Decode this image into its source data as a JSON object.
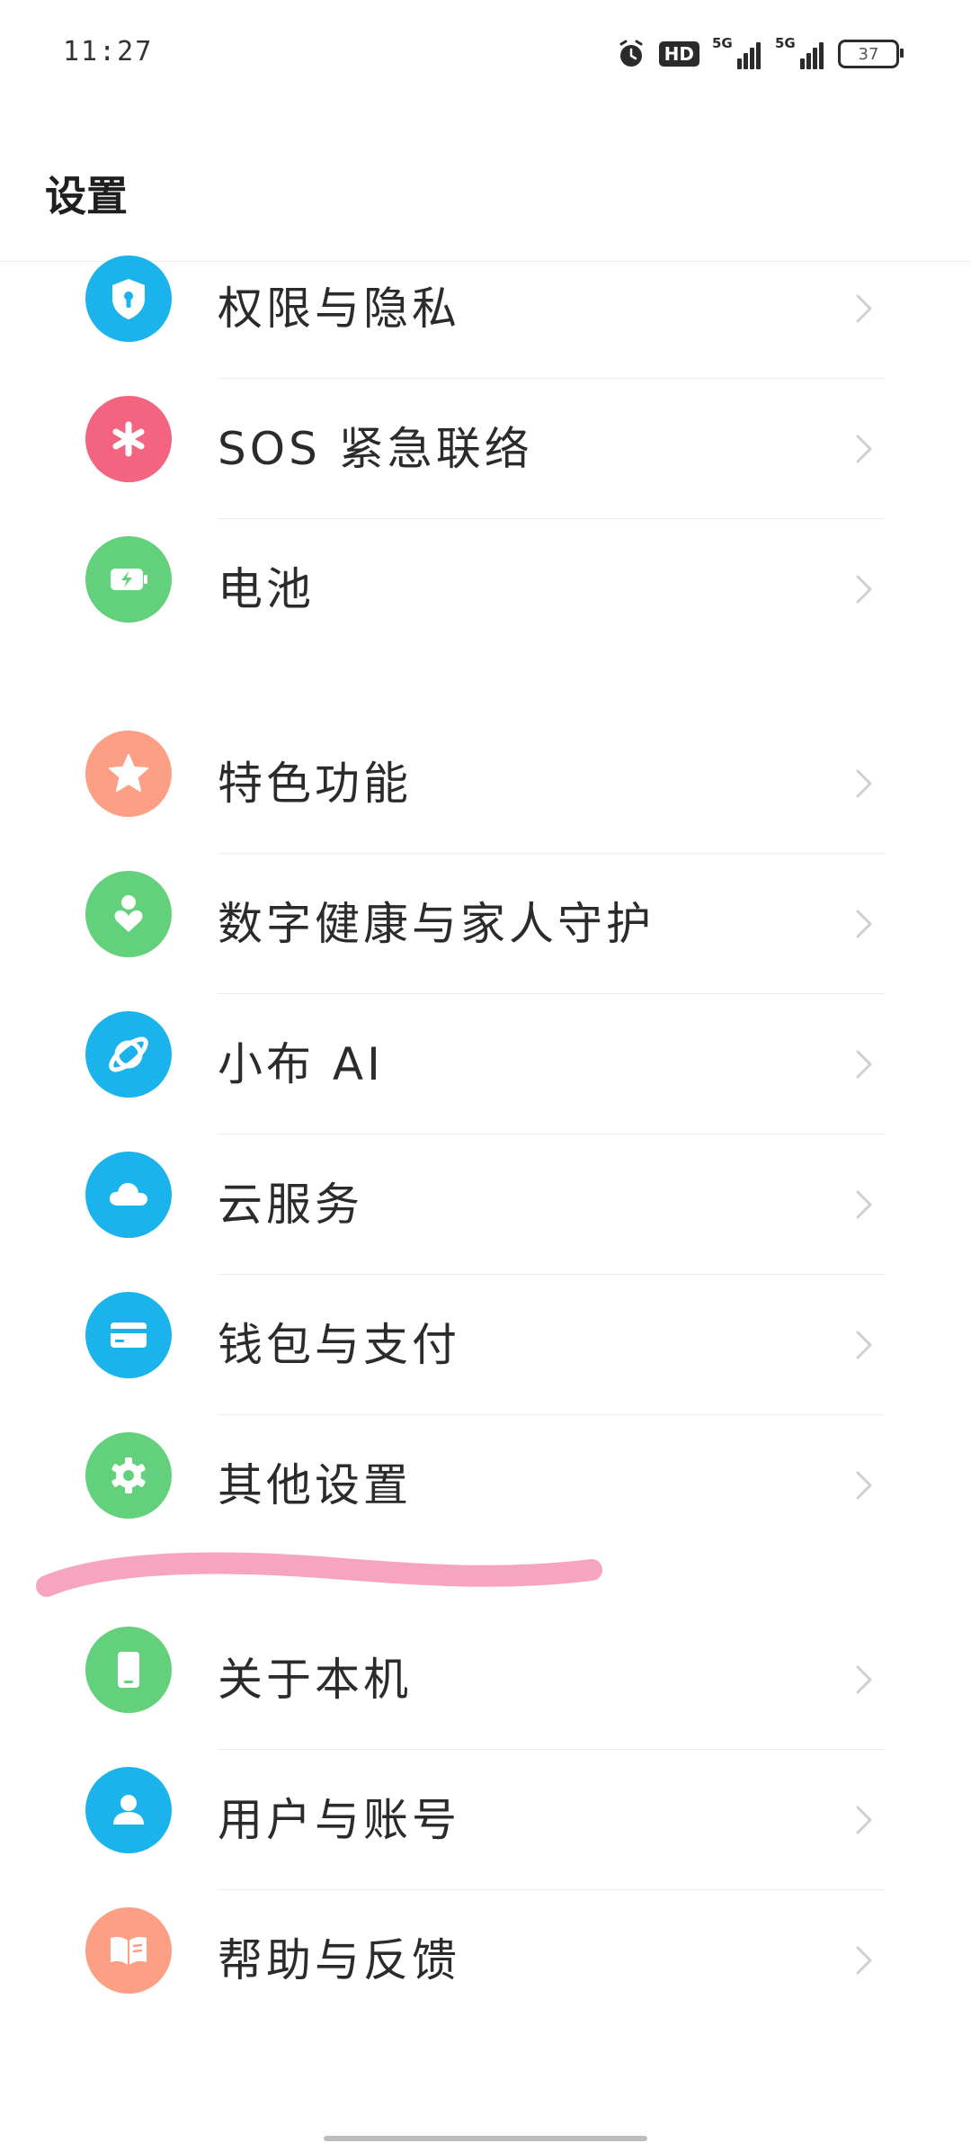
{
  "status_bar": {
    "time": "11:27",
    "hd_label": "HD",
    "signal1_label": "5G",
    "signal2_label": "5G",
    "battery": "37"
  },
  "header": {
    "title": "设置"
  },
  "items": [
    {
      "label": "权限与隐私",
      "icon": "shield-lock-icon",
      "color": "#1ab3ec"
    },
    {
      "label": "SOS 紧急联络",
      "icon": "asterisk-icon",
      "color": "#f2647f"
    },
    {
      "label": "电池",
      "icon": "battery-charge-icon",
      "color": "#63d07c"
    },
    {
      "label": "特色功能",
      "icon": "star-icon",
      "color": "#fc9f84"
    },
    {
      "label": "数字健康与家人守护",
      "icon": "person-heart-icon",
      "color": "#63d07c"
    },
    {
      "label": "小布 AI",
      "icon": "orbit-icon",
      "color": "#1ab3ec"
    },
    {
      "label": "云服务",
      "icon": "cloud-icon",
      "color": "#1ab3ec"
    },
    {
      "label": "钱包与支付",
      "icon": "card-icon",
      "color": "#1ab3ec"
    },
    {
      "label": "其他设置",
      "icon": "gear-icon",
      "color": "#63d07c"
    },
    {
      "label": "关于本机",
      "icon": "phone-icon",
      "color": "#63d07c"
    },
    {
      "label": "用户与账号",
      "icon": "user-icon",
      "color": "#1ab3ec"
    },
    {
      "label": "帮助与反馈",
      "icon": "book-icon",
      "color": "#fc9f84"
    }
  ],
  "annotation": {
    "highlighted_item": "其他设置",
    "stroke_color": "#f59ab8"
  }
}
